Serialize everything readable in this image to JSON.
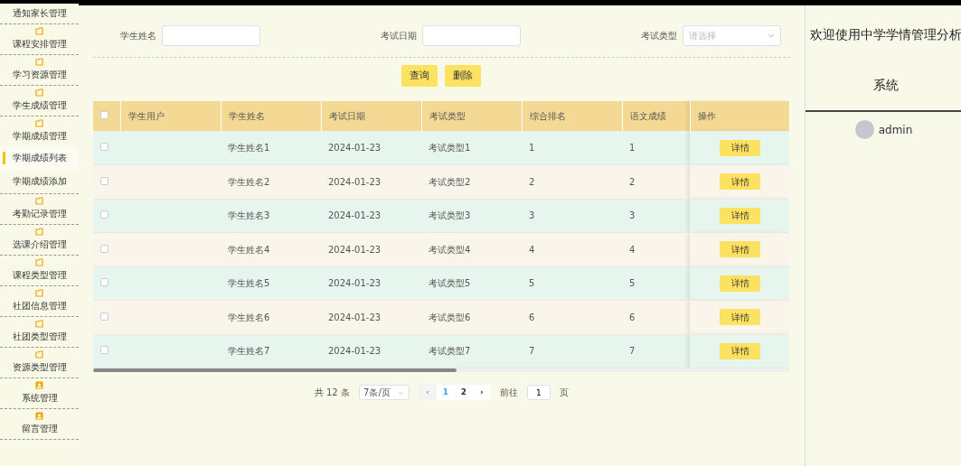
{
  "sidebar": {
    "items": [
      {
        "label": "通知家长管理"
      },
      {
        "label": "课程安排管理",
        "kind": "folder"
      },
      {
        "label": "学习资源管理",
        "kind": "folder"
      },
      {
        "label": "学生成绩管理",
        "kind": "folder"
      },
      {
        "label": "学期成绩管理",
        "kind": "folder",
        "children": [
          {
            "label": "学期成绩列表",
            "selected": true
          },
          {
            "label": "学期成绩添加",
            "selected": false
          }
        ]
      },
      {
        "label": "考勤记录管理",
        "kind": "folder"
      },
      {
        "label": "选课介绍管理",
        "kind": "folder"
      },
      {
        "label": "课程类型管理",
        "kind": "folder"
      },
      {
        "label": "社团信息管理",
        "kind": "folder"
      },
      {
        "label": "社团类型管理",
        "kind": "folder"
      },
      {
        "label": "资源类型管理",
        "kind": "folder"
      },
      {
        "label": "系统管理",
        "kind": "person"
      },
      {
        "label": "留言管理",
        "kind": "person"
      }
    ]
  },
  "filters": [
    {
      "label": "学生姓名",
      "kind": "text"
    },
    {
      "label": "考试日期",
      "kind": "text"
    },
    {
      "label": "考试类型",
      "kind": "select",
      "placeholder": "请选择"
    }
  ],
  "actions": [
    "查询",
    "删除"
  ],
  "table": {
    "all_checked": false,
    "columns": [
      "学生用户",
      "学生姓名",
      "考试日期",
      "考试类型",
      "综合排名",
      "语文成绩",
      "操作"
    ],
    "rows": [
      {
        "checked": false,
        "cells": [
          "",
          "学生姓名1",
          "2024-01-23",
          "考试类型1",
          "1",
          "1"
        ],
        "action": "详情"
      },
      {
        "checked": false,
        "cells": [
          "",
          "学生姓名2",
          "2024-01-23",
          "考试类型2",
          "2",
          "2"
        ],
        "action": "详情"
      },
      {
        "checked": false,
        "cells": [
          "",
          "学生姓名3",
          "2024-01-23",
          "考试类型3",
          "3",
          "3"
        ],
        "action": "详情"
      },
      {
        "checked": false,
        "cells": [
          "",
          "学生姓名4",
          "2024-01-23",
          "考试类型4",
          "4",
          "4"
        ],
        "action": "详情"
      },
      {
        "checked": false,
        "cells": [
          "",
          "学生姓名5",
          "2024-01-23",
          "考试类型5",
          "5",
          "5"
        ],
        "action": "详情"
      },
      {
        "checked": false,
        "cells": [
          "",
          "学生姓名6",
          "2024-01-23",
          "考试类型6",
          "6",
          "6"
        ],
        "action": "详情"
      },
      {
        "checked": false,
        "cells": [
          "",
          "学生姓名7",
          "2024-01-23",
          "考试类型7",
          "7",
          "7"
        ],
        "action": "详情"
      }
    ]
  },
  "pagination": {
    "total": "共 12 条",
    "page_size": "7条/页",
    "prev": "‹",
    "pages": [
      {
        "label": "1",
        "selected": true
      },
      {
        "label": "2",
        "selected": false
      }
    ],
    "next": "›",
    "goto_label": "前往",
    "goto_value": "1",
    "goto_suffix": "页"
  },
  "header": {
    "title": "欢迎使用中学学情管理分析系统",
    "user": "admin"
  }
}
